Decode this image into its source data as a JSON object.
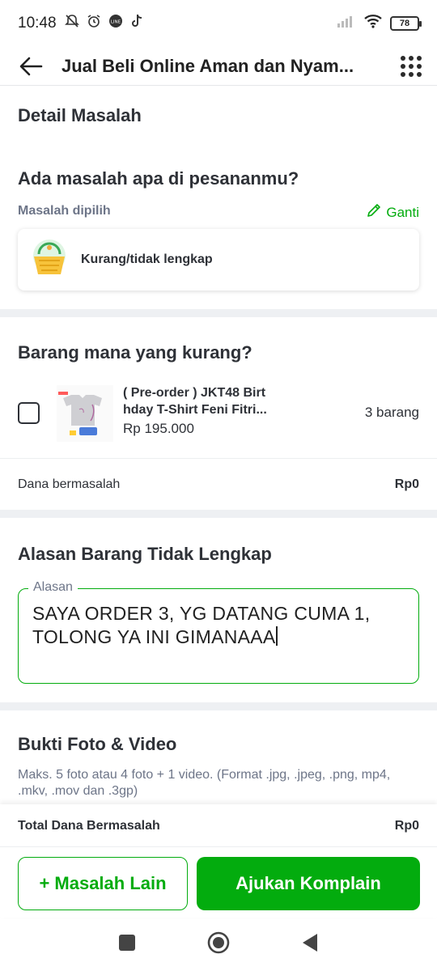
{
  "status_bar": {
    "time": "10:48",
    "battery": "78"
  },
  "header": {
    "title": "Jual Beli Online Aman dan Nyam..."
  },
  "detail": {
    "section_title": "Detail Masalah",
    "question": "Ada masalah apa di pesananmu?",
    "selected_label": "Masalah dipilih",
    "change_label": "Ganti",
    "selected_issue": "Kurang/tidak lengkap"
  },
  "items": {
    "question": "Barang mana yang kurang?",
    "product": {
      "name_line1": "( Pre-order ) JKT48 Birt",
      "name_line2": "hday T-Shirt Feni Fitri...",
      "price": "Rp 195.000",
      "quantity": "3 barang",
      "checked": false
    },
    "fund_label": "Dana bermasalah",
    "fund_value": "Rp0"
  },
  "reason": {
    "section_title": "Alasan Barang Tidak Lengkap",
    "field_label": "Alasan",
    "line1": "SAYA ORDER 3, YG DATANG CUMA 1,",
    "line2": "TOLONG YA INI GIMANAAA"
  },
  "evidence": {
    "section_title": "Bukti Foto & Video",
    "hint": "Maks. 5 foto atau 4 foto + 1 video. (Format .jpg, .jpeg, .png, mp4, .mkv, .mov dan .3gp)"
  },
  "footer": {
    "total_label": "Total Dana Bermasalah",
    "total_value": "Rp0",
    "secondary_button": "+ Masalah Lain",
    "primary_button": "Ajukan Komplain"
  },
  "colors": {
    "accent": "#03ac0e",
    "text": "#2e3137",
    "muted": "#6d7588"
  }
}
